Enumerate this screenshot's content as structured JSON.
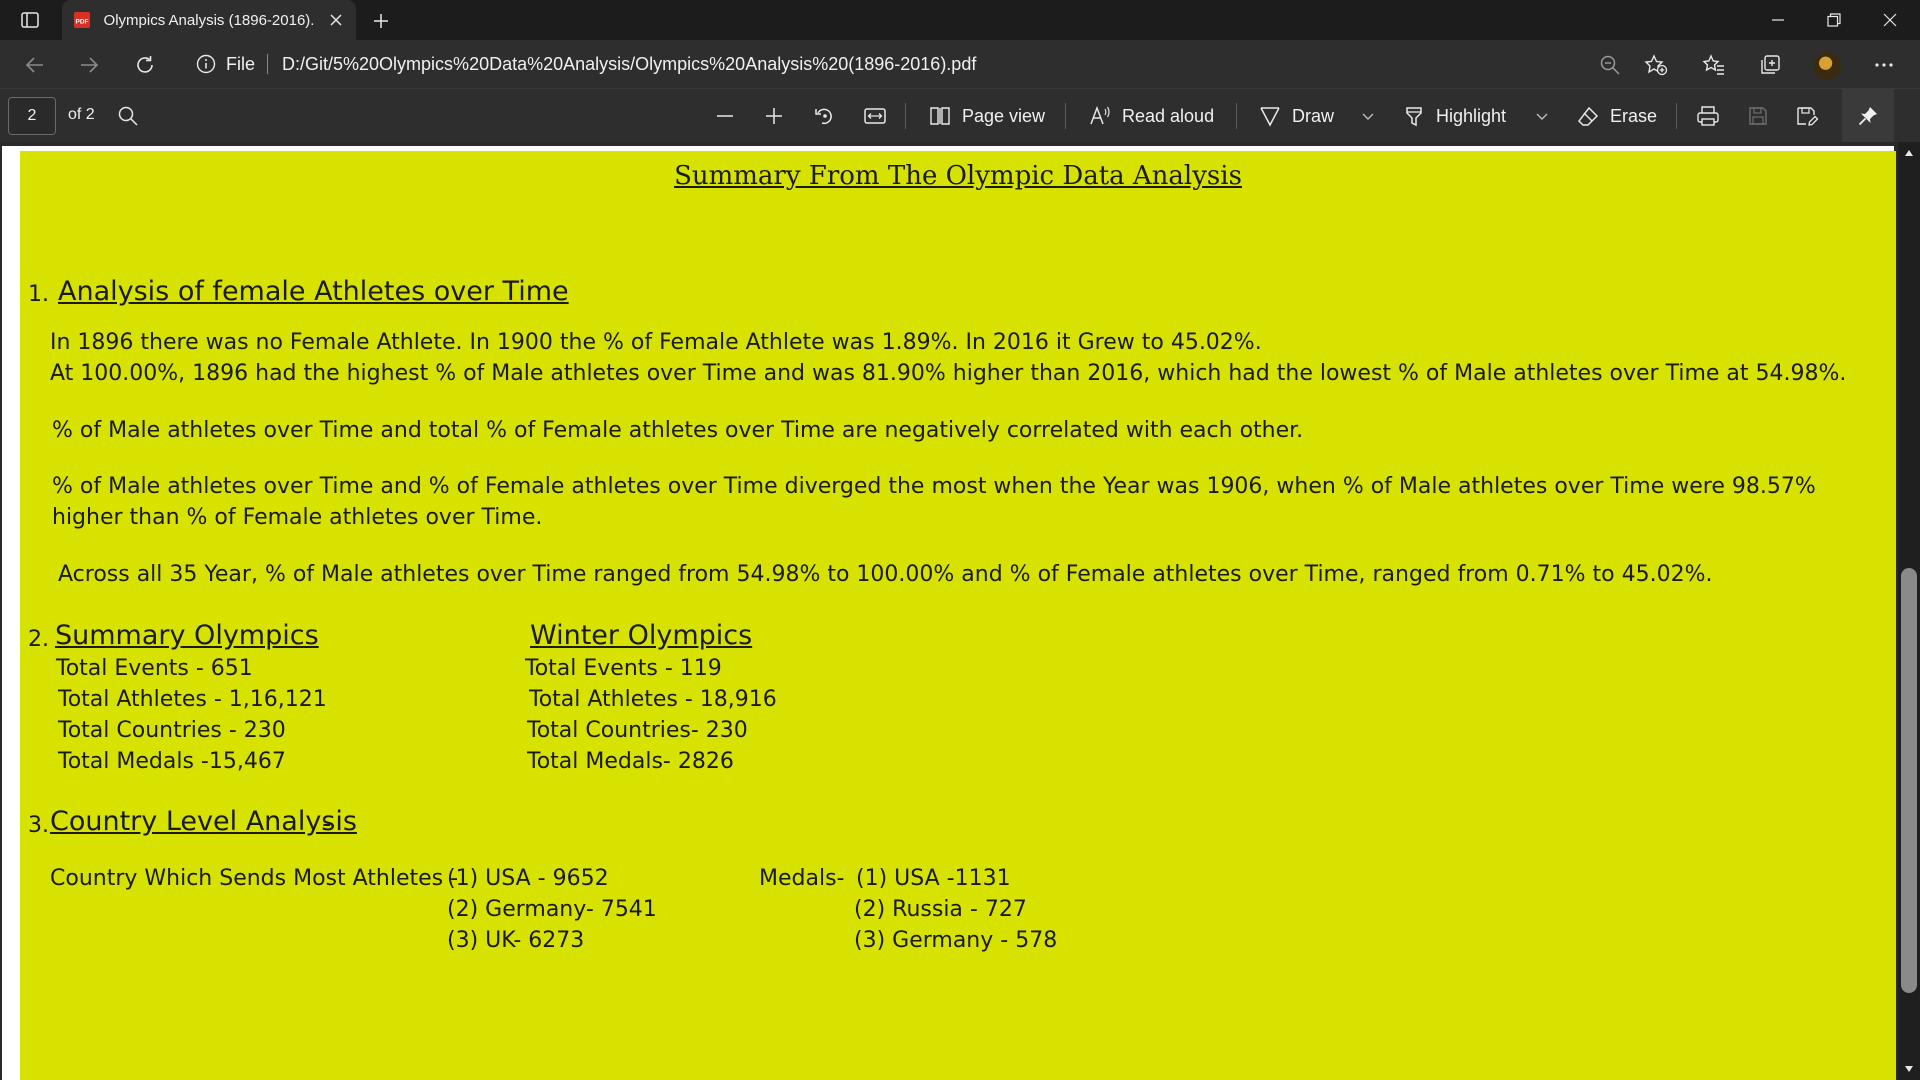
{
  "browser": {
    "tab": {
      "title": "Olympics Analysis (1896-2016).pdf",
      "favicon": "pdf-icon"
    },
    "address": {
      "scheme": "File",
      "url": "D:/Git/5%20Olympics%20Data%20Analysis/Olympics%20Analysis%20(1896-2016).pdf"
    }
  },
  "pdf_toolbar": {
    "page_number": "2",
    "page_total": "of 2",
    "page_view": "Page view",
    "read_aloud": "Read aloud",
    "draw": "Draw",
    "highlight": "Highlight",
    "erase": "Erase"
  },
  "document": {
    "background_color": "#d7e200",
    "title": "Summary From The Olympic Data Analysis",
    "section1": {
      "number": "1.",
      "heading": "Analysis of female Athletes over Time",
      "p1_line1": "In 1896 there was no Female Athlete. In 1900 the % of Female Athlete was 1.89%. In 2016 it Grew to 45.02%.",
      "p1_line2": "At 100.00%, 1896 had the highest % of Male athletes over Time and was 81.90% higher than 2016, which had the lowest % of Male athletes over Time at 54.98%.",
      "p2": "% of Male athletes over Time and total % of Female athletes over Time are negatively correlated with each other.",
      "p3_line1": "% of Male athletes over Time and % of Female athletes over Time diverged the most when the Year was 1906, when % of Male athletes over Time were 98.57%",
      "p3_line2": "higher than % of Female athletes over Time.",
      "p4": "Across all 35 Year, % of Male athletes over Time ranged from 54.98% to 100.00% and % of Female athletes over Time, ranged from 0.71% to 45.02%."
    },
    "section2": {
      "number": "2.",
      "summary_heading": "Summary Olympics",
      "summary_stats": [
        "Total Events - 651",
        "Total Athletes - 1,16,121",
        "Total Countries - 230",
        "Total Medals -15,467"
      ],
      "winter_heading": "Winter Olympics",
      "winter_stats": [
        "Total Events - 119",
        "Total Athletes - 18,916",
        "Total Countries- 230",
        "Total Medals- 2826"
      ]
    },
    "section3": {
      "number": "3.",
      "heading": "Country Level Analysis",
      "heading_suffix": "-",
      "athletes_label": "Country Which Sends Most Athletes -",
      "athletes": [
        "(1)  USA - 9652",
        "(2) Germany- 7541",
        "(3) UK- 6273"
      ],
      "medals_label": "Medals-",
      "medals": [
        "(1) USA -1131",
        "(2) Russia - 727",
        "(3) Germany - 578"
      ]
    }
  }
}
